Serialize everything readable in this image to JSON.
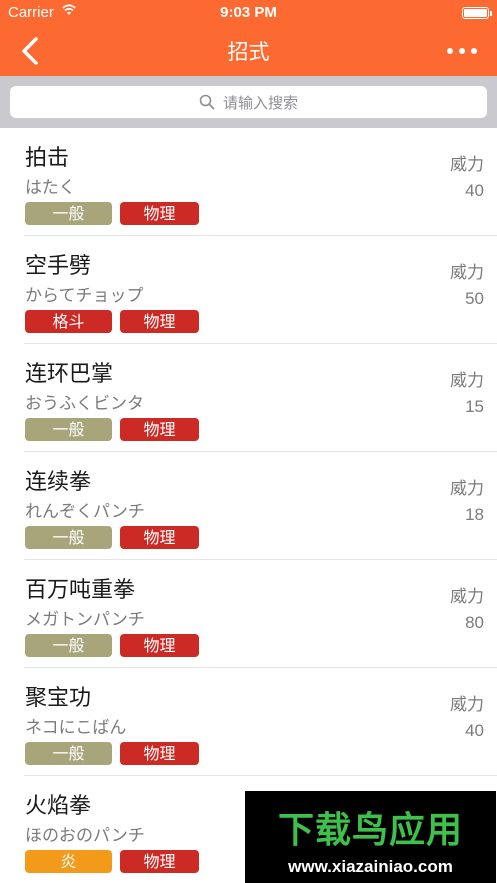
{
  "status_bar": {
    "carrier": "Carrier",
    "time": "9:03 PM"
  },
  "nav": {
    "title": "招式",
    "back_icon": "chevron-left-icon",
    "more_icon": "more-dots-icon"
  },
  "search": {
    "placeholder": "请输入搜索",
    "icon": "search-icon"
  },
  "colors": {
    "accent": "#FC6A32",
    "tag_normal": "#A8A57A",
    "tag_physical": "#CC2B25",
    "tag_fighting": "#CC2B25",
    "tag_fire": "#F39A1B"
  },
  "moves": [
    {
      "name": "拍击",
      "kana": "はたく",
      "type": "一般",
      "type_color": "#A8A57A",
      "category": "物理",
      "category_color": "#CC2B25",
      "power_label": "威力",
      "power": "40"
    },
    {
      "name": "空手劈",
      "kana": "からてチョップ",
      "type": "格斗",
      "type_color": "#CC2B25",
      "category": "物理",
      "category_color": "#CC2B25",
      "power_label": "威力",
      "power": "50"
    },
    {
      "name": "连环巴掌",
      "kana": "おうふくビンタ",
      "type": "一般",
      "type_color": "#A8A57A",
      "category": "物理",
      "category_color": "#CC2B25",
      "power_label": "威力",
      "power": "15"
    },
    {
      "name": "连续拳",
      "kana": "れんぞくパンチ",
      "type": "一般",
      "type_color": "#A8A57A",
      "category": "物理",
      "category_color": "#CC2B25",
      "power_label": "威力",
      "power": "18"
    },
    {
      "name": "百万吨重拳",
      "kana": "メガトンパンチ",
      "type": "一般",
      "type_color": "#A8A57A",
      "category": "物理",
      "category_color": "#CC2B25",
      "power_label": "威力",
      "power": "80"
    },
    {
      "name": "聚宝功",
      "kana": "ネコにこばん",
      "type": "一般",
      "type_color": "#A8A57A",
      "category": "物理",
      "category_color": "#CC2B25",
      "power_label": "威力",
      "power": "40"
    },
    {
      "name": "火焰拳",
      "kana": "ほのおのパンチ",
      "type": "炎",
      "type_color": "#F39A1B",
      "category": "物理",
      "category_color": "#CC2B25"
    }
  ],
  "watermark": {
    "title": "下载鸟应用",
    "url": "www.xiazainiao.com"
  }
}
